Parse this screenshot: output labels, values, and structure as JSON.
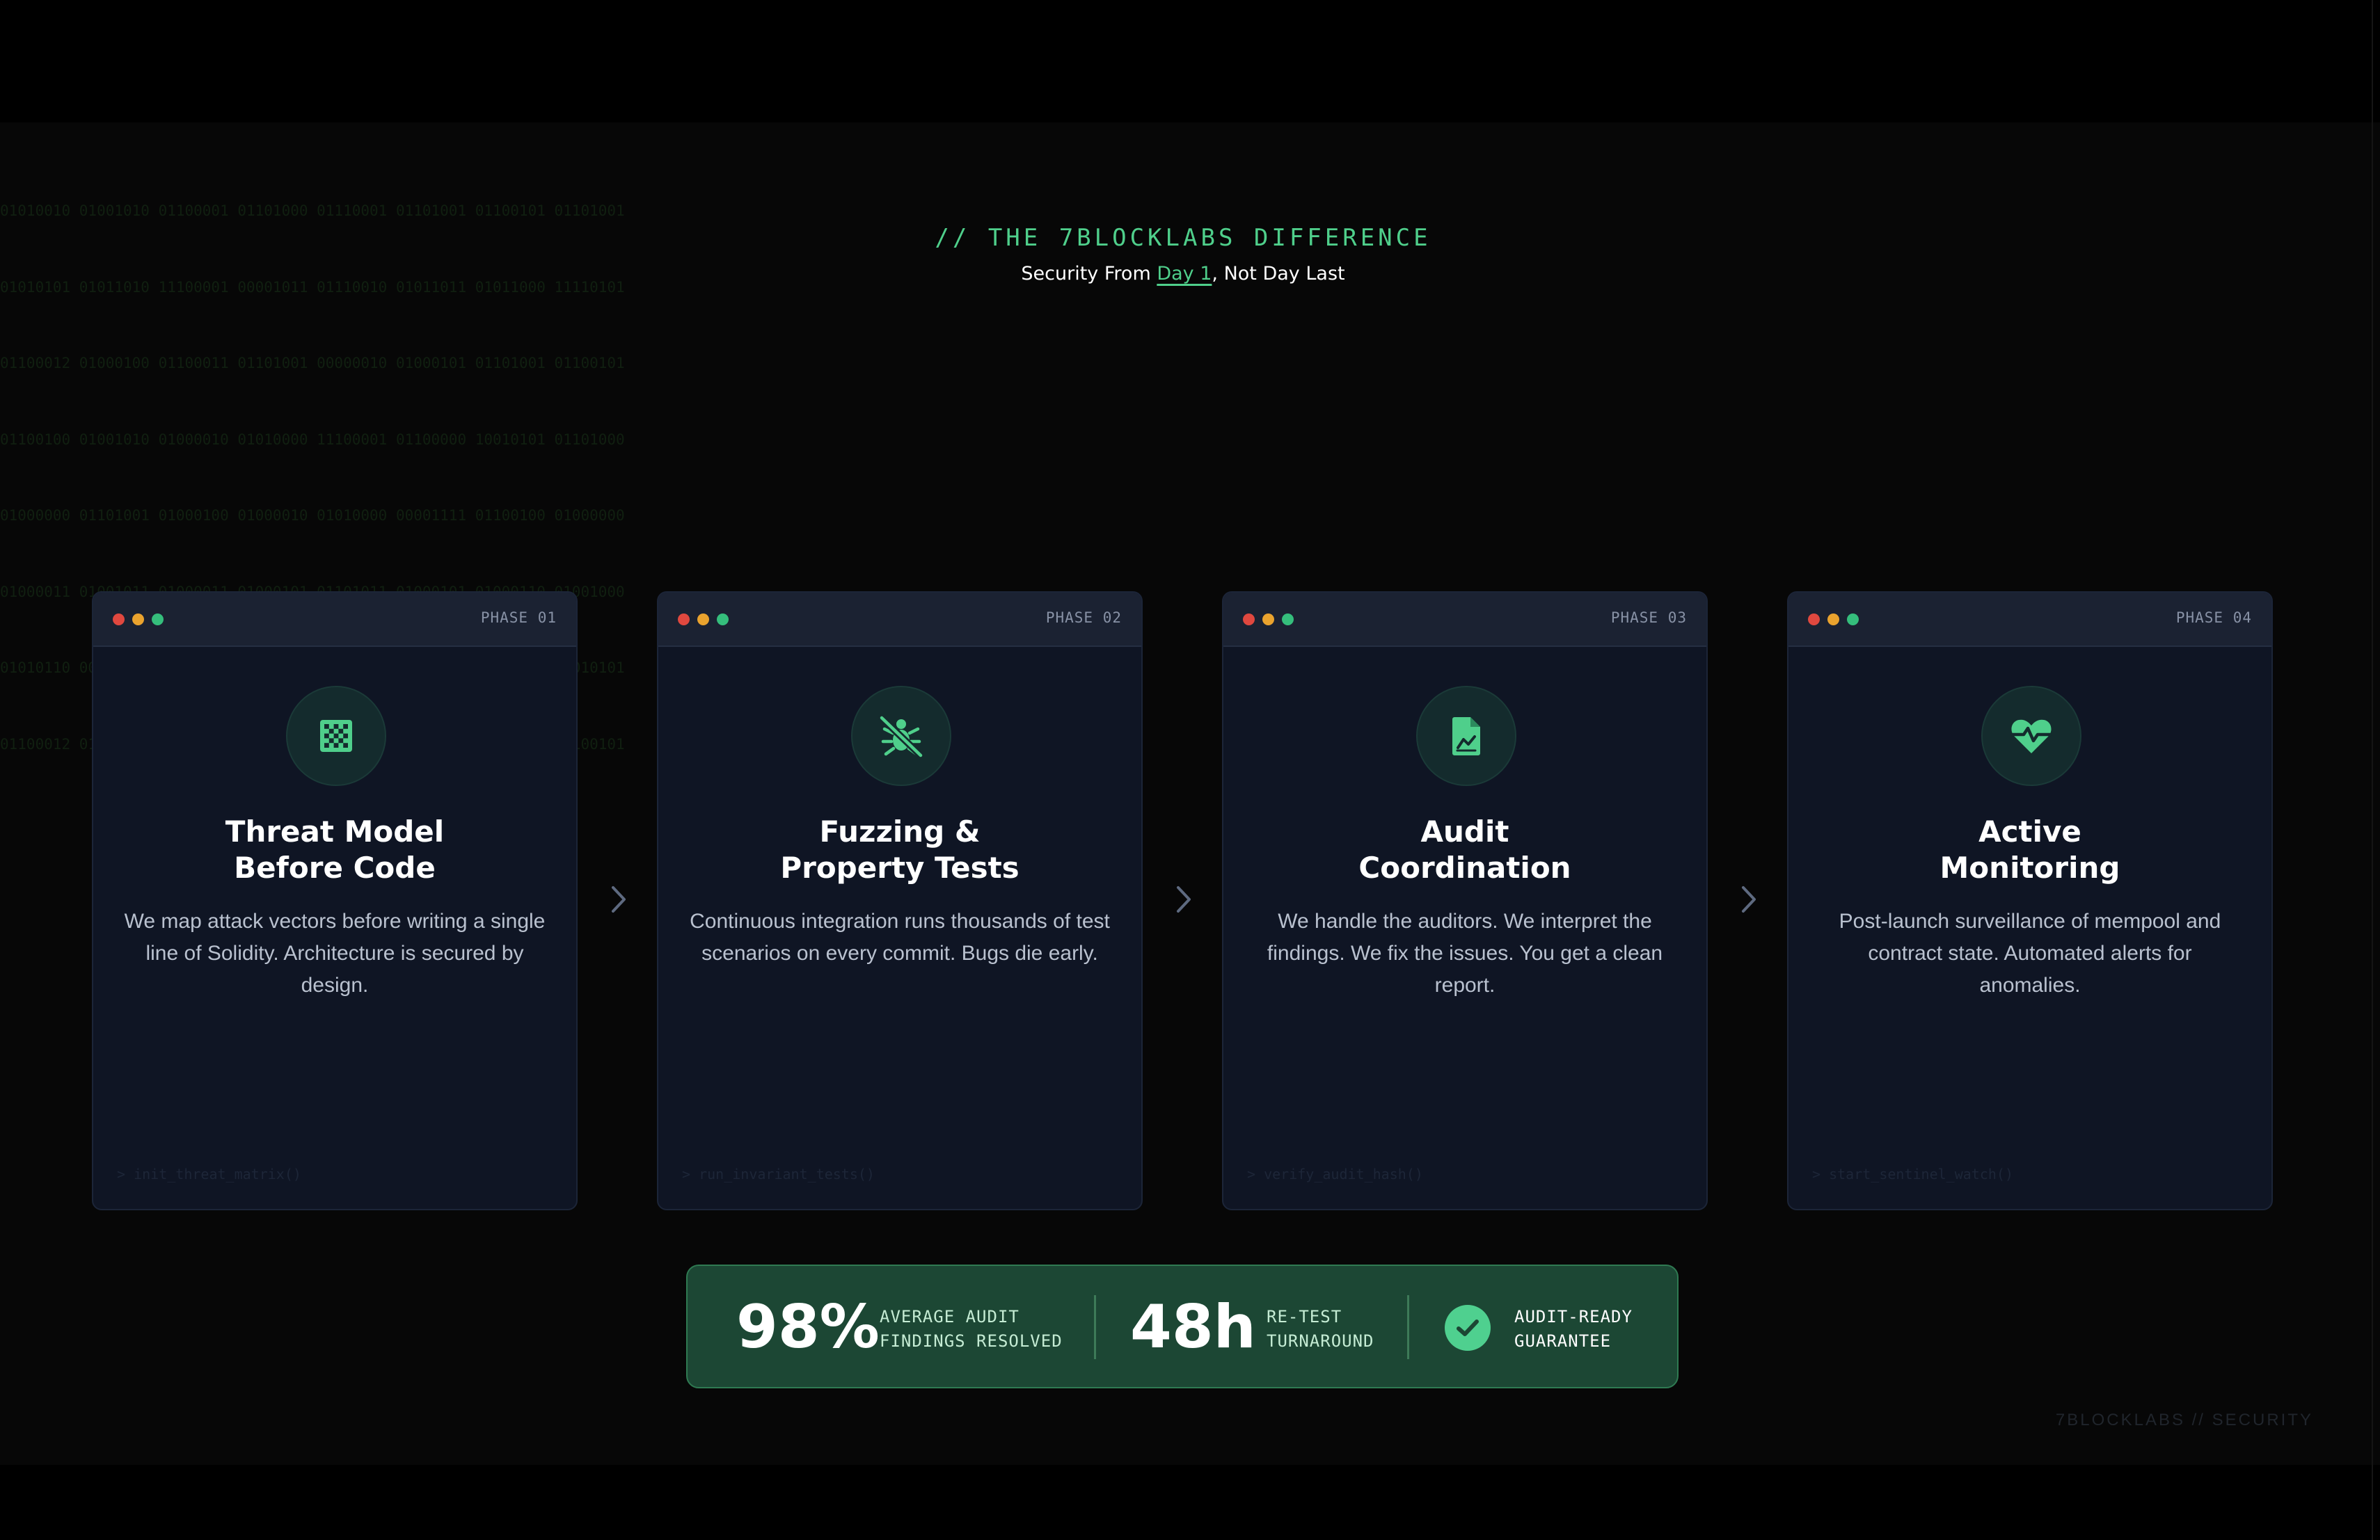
{
  "colors": {
    "accent": "#4fcf8b",
    "card_bg": "#0f1524",
    "stats_bg": "#1c4734"
  },
  "background_binary": [
    "01010010 01001010 01100001 01101000 01110001 01101001 01100101 01101001",
    "01010101 01011010 11100001 00001011 01110010 01011011 01011000 11110101",
    "01100012 01000100 01100011 01101001 00000010 01000101 01101001 01100101",
    "01100100 01001010 01000010 01010000 11100001 01100000 10010101 01101000",
    "01000000 01101001 01000100 01000010 01010000 00001111 01100100 01000000",
    "01000011 01001011 01000011 01000101 01101011 01000101 01000110 01001000",
    "01010110 00101000 11100001 00001010 11010011 01001001 00000110 10010101",
    "01100012 01000100 01100011 01101001 00000010 01000101 01101001 01100101"
  ],
  "header": {
    "eyebrow": "// THE 7BLOCKLABS DIFFERENCE",
    "subtitle_before": "Security From ",
    "subtitle_highlight": "Day 1",
    "subtitle_after": ", Not Day Last"
  },
  "phases": [
    {
      "phase": "PHASE 01",
      "icon": "chess-board-icon",
      "title_line1": "Threat Model",
      "title_line2": "Before Code",
      "description": "We map attack vectors before writing a single line of Solidity. Architecture is secured by design.",
      "command": "> init_threat_matrix()"
    },
    {
      "phase": "PHASE 02",
      "icon": "bug-slash-icon",
      "title_line1": "Fuzzing &",
      "title_line2": "Property Tests",
      "description": "Continuous integration runs thousands of test scenarios on every commit. Bugs die early.",
      "command": "> run_invariant_tests()"
    },
    {
      "phase": "PHASE 03",
      "icon": "file-chart-icon",
      "title_line1": "Audit",
      "title_line2": "Coordination",
      "description": "We handle the auditors. We interpret the findings. We fix the issues. You get a clean report.",
      "command": "> verify_audit_hash()"
    },
    {
      "phase": "PHASE 04",
      "icon": "heart-pulse-icon",
      "title_line1": "Active",
      "title_line2": "Monitoring",
      "description": "Post-launch surveillance of mempool and contract state. Automated alerts for anomalies.",
      "command": "> start_sentinel_watch()"
    }
  ],
  "stats": {
    "stat1_value": "98%",
    "stat1_label_line1": "AVERAGE AUDIT",
    "stat1_label_line2": "FINDINGS RESOLVED",
    "stat2_value": "48h",
    "stat2_label_line1": "RE-TEST",
    "stat2_label_line2": "TURNAROUND",
    "guarantee_line1": "AUDIT-READY",
    "guarantee_line2": "GUARANTEE"
  },
  "footer": {
    "brand": "7BLOCKLABS // SECURITY"
  }
}
